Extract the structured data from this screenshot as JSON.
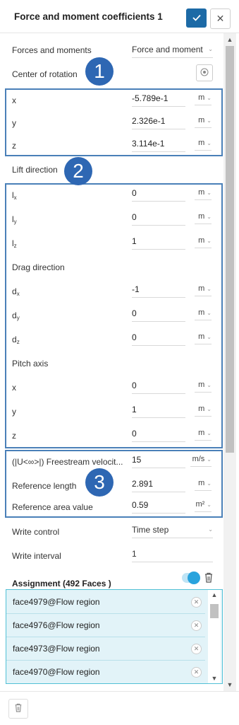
{
  "header": {
    "title": "Force and moment coefficients 1",
    "confirm_icon": "check-icon",
    "close_icon": "close-icon"
  },
  "forces_and_moments": {
    "label": "Forces and moments",
    "value": "Force and moment"
  },
  "center_of_rotation": {
    "label": "Center of rotation",
    "rows": [
      {
        "label": "x",
        "value": "-5.789e-1",
        "unit": "m"
      },
      {
        "label": "y",
        "value": "2.326e-1",
        "unit": "m"
      },
      {
        "label": "z",
        "value": "3.114e-1",
        "unit": "m"
      }
    ]
  },
  "lift_direction": {
    "label": "Lift direction",
    "rows": [
      {
        "label": "l",
        "sub": "x",
        "value": "0",
        "unit": "m"
      },
      {
        "label": "l",
        "sub": "y",
        "value": "0",
        "unit": "m"
      },
      {
        "label": "l",
        "sub": "z",
        "value": "1",
        "unit": "m"
      }
    ]
  },
  "drag_direction": {
    "label": "Drag direction",
    "rows": [
      {
        "label": "d",
        "sub": "x",
        "value": "-1",
        "unit": "m"
      },
      {
        "label": "d",
        "sub": "y",
        "value": "0",
        "unit": "m"
      },
      {
        "label": "d",
        "sub": "z",
        "value": "0",
        "unit": "m"
      }
    ]
  },
  "pitch_axis": {
    "label": "Pitch axis",
    "rows": [
      {
        "label": "x",
        "value": "0",
        "unit": "m"
      },
      {
        "label": "y",
        "value": "1",
        "unit": "m"
      },
      {
        "label": "z",
        "value": "0",
        "unit": "m"
      }
    ]
  },
  "reference": {
    "rows": [
      {
        "label": "(|U<∞>|) Freestream velocit...",
        "value": "15",
        "unit": "m/s"
      },
      {
        "label": "Reference length",
        "value": "2.891",
        "unit": "m"
      },
      {
        "label": "Reference area value",
        "value": "0.59",
        "unit": "m²"
      }
    ]
  },
  "write_control": {
    "label": "Write control",
    "value": "Time step"
  },
  "write_interval": {
    "label": "Write interval",
    "value": "1"
  },
  "assignment": {
    "title": "Assignment (492 Faces )",
    "faces": [
      "face4979@Flow region",
      "face4976@Flow region",
      "face4973@Flow region",
      "face4970@Flow region"
    ]
  },
  "badges": [
    "1",
    "2",
    "3"
  ],
  "colors": {
    "accent": "#1c6aa6",
    "annotation": "#2e67b3",
    "selection_bg": "#e2f3f8",
    "toggle": "#29a3dd"
  }
}
